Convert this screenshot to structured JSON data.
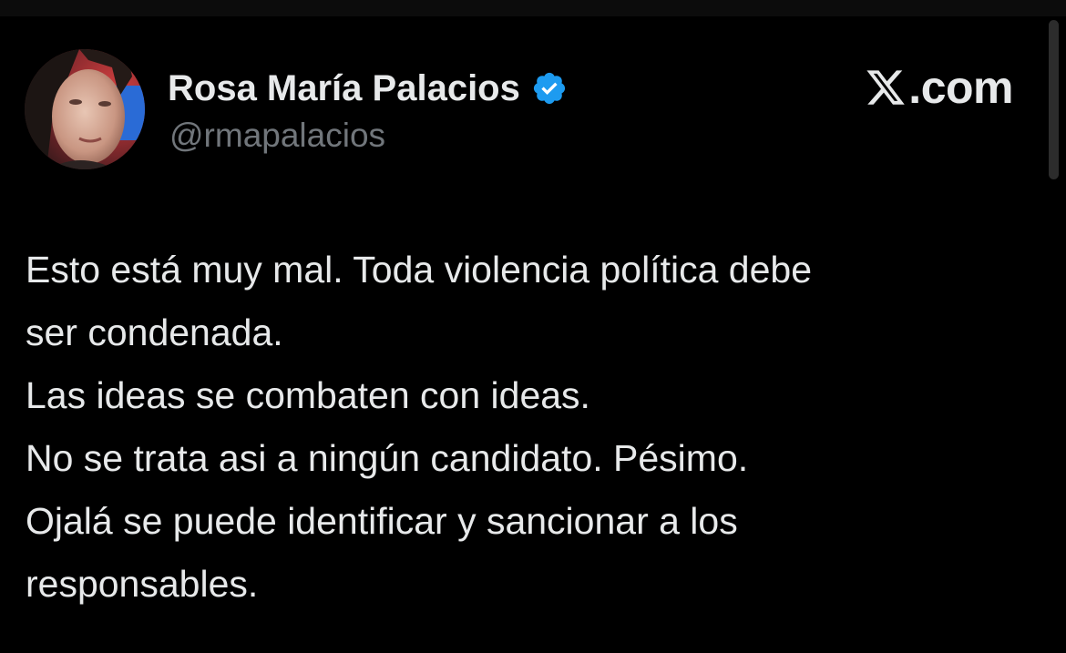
{
  "author": {
    "display_name": "Rosa María Palacios",
    "handle": "@rmapalacios",
    "verified": true,
    "verified_color": "#1d9bf0"
  },
  "site": {
    "logo": "x-logo-icon",
    "label": ".com"
  },
  "tweet": {
    "lines": [
      "Esto está muy mal. Toda violencia política debe",
      "ser condenada.",
      "Las ideas se combaten con ideas.",
      "No se trata asi a ningún candidato. Pésimo.",
      "Ojalá se puede identificar y sancionar a los",
      "responsables."
    ]
  },
  "theme": {
    "background": "#000000",
    "text": "#e7e9ea",
    "secondary_text": "#71767b"
  }
}
